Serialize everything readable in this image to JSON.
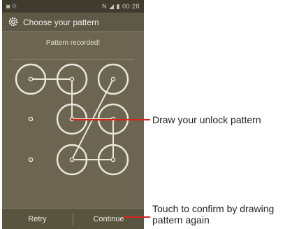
{
  "status_bar": {
    "left_icons": "◙ ⟐",
    "right_text": "N  ◢ ▮ 00:28"
  },
  "header": {
    "icon": "gear-icon",
    "title": "Choose your pattern"
  },
  "message": "Pattern recorded!",
  "pattern": {
    "rows": 3,
    "cols": 3,
    "selected": [
      [
        0,
        0
      ],
      [
        0,
        1
      ],
      [
        0,
        2
      ],
      [
        1,
        1
      ],
      [
        1,
        2
      ],
      [
        2,
        1
      ],
      [
        2,
        2
      ]
    ],
    "path": [
      [
        0,
        0
      ],
      [
        0,
        1
      ],
      [
        1,
        1
      ],
      [
        1,
        2
      ],
      [
        2,
        2
      ],
      [
        2,
        1
      ],
      [
        0,
        2
      ]
    ]
  },
  "buttons": {
    "retry": "Retry",
    "continue": "Continue"
  },
  "callouts": {
    "draw": "Draw your unlock pattern",
    "confirm": "Touch to confirm by drawing pattern again"
  },
  "colors": {
    "screen_bg": "#6b6551",
    "ring": "#e9e6da",
    "line": "#e9e6da",
    "callout_line": "#d7241f"
  }
}
